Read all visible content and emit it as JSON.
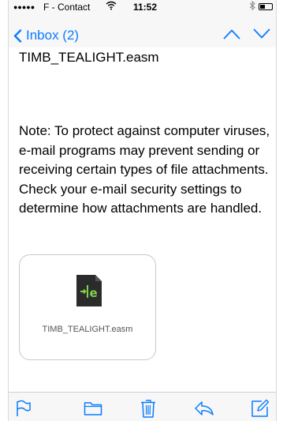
{
  "status_bar": {
    "signal": "●●●●●",
    "carrier": "F - Contact",
    "wifi_icon": "wifi-icon",
    "time": "11:52",
    "bluetooth_icon": "bluetooth-icon",
    "battery_icon": "battery-icon"
  },
  "nav": {
    "back_label": "Inbox (2)",
    "up_icon": "chevron-up-icon",
    "down_icon": "chevron-down-icon"
  },
  "message": {
    "filename_line": "TIMB_TEALIGHT.easm",
    "note": "Note: To protect against computer viruses, e-mail programs may prevent sending or receiving certain types of file attachments.  Check your e-mail security settings to determine how attachments are handled.",
    "attachment": {
      "name": "TIMB_TEALIGHT.easm",
      "icon": "file-icon"
    }
  },
  "toolbar": {
    "items": [
      "flag-icon",
      "folder-icon",
      "trash-icon",
      "reply-icon",
      "compose-icon"
    ]
  },
  "colors": {
    "accent": "#0a7cff",
    "background": "#ffffff",
    "bar_background": "#f7f7f7"
  }
}
